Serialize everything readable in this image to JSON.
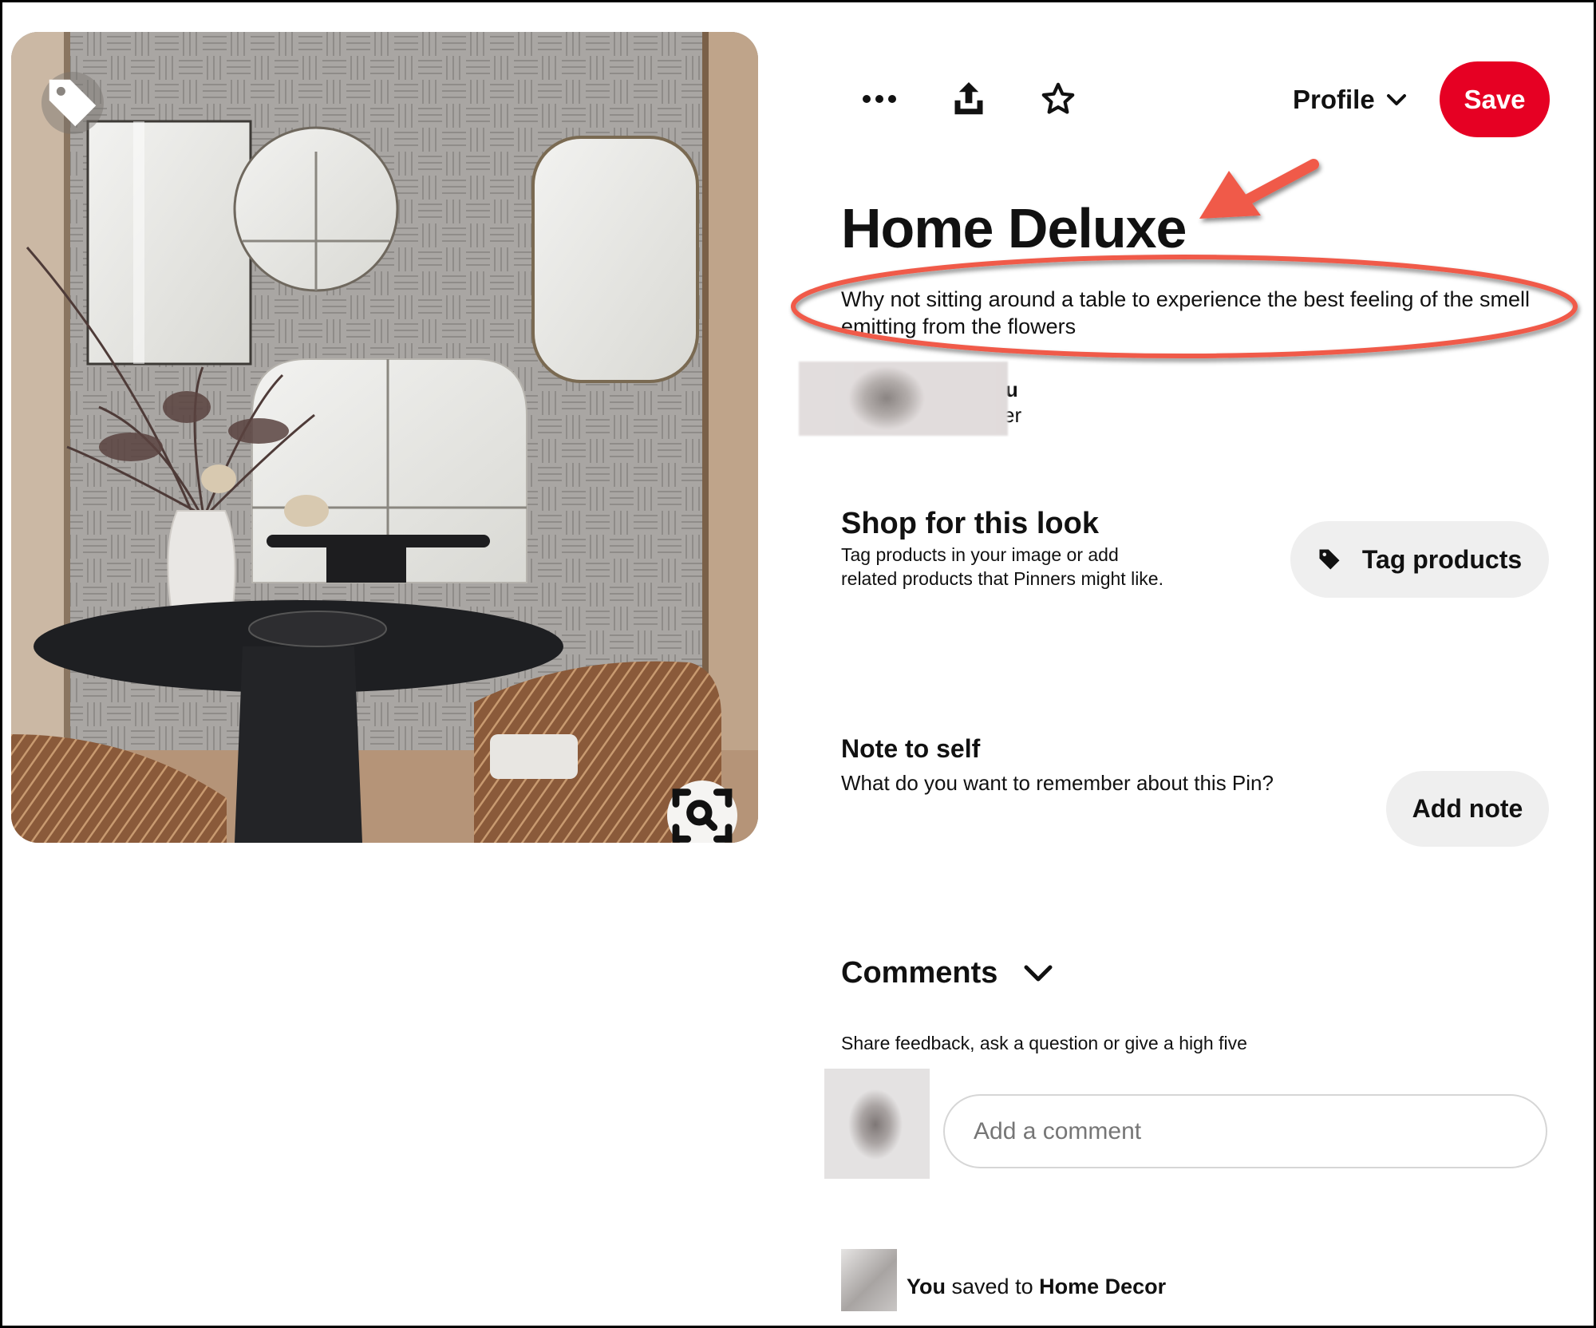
{
  "toolbar": {
    "more_icon": "more-horizontal-icon",
    "share_icon": "share-upload-icon",
    "favorite_icon": "star-outline-icon",
    "profile_label": "Profile",
    "profile_icon": "chevron-down-icon",
    "save_label": "Save"
  },
  "image": {
    "tag_icon": "tag-icon",
    "visual_search_icon": "visual-search-icon",
    "alt": "Dining room with round black table, rattan chairs, vase of dried flowers and four mirrors on textured wall"
  },
  "pin": {
    "title": "Home Deluxe",
    "description": "Why not sitting around a table to experience the best feeling of the smell emitting from the flowers"
  },
  "creator": {
    "name_visible": "u",
    "subtitle_visible": "er"
  },
  "shop": {
    "title": "Shop for this look",
    "description": "Tag products in your image or add related products that Pinners might like.",
    "button_label": "Tag products",
    "button_icon": "tag-icon"
  },
  "note": {
    "title": "Note to self",
    "description": "What do you want to remember about this Pin?",
    "button_label": "Add note"
  },
  "comments": {
    "title": "Comments",
    "toggle_icon": "chevron-down-icon",
    "prompt": "Share feedback, ask a question or give a high five",
    "input_placeholder": "Add a comment",
    "input_value": ""
  },
  "saved": {
    "actor": "You",
    "verb": "saved to",
    "board": "Home Decor"
  },
  "colors": {
    "save_button": "#e60023",
    "pill_button_bg": "#efefef",
    "annotation_red": "#f05a4a"
  },
  "annotations": {
    "arrow": "red arrow pointing to title",
    "ellipse": "red ellipse around description"
  }
}
